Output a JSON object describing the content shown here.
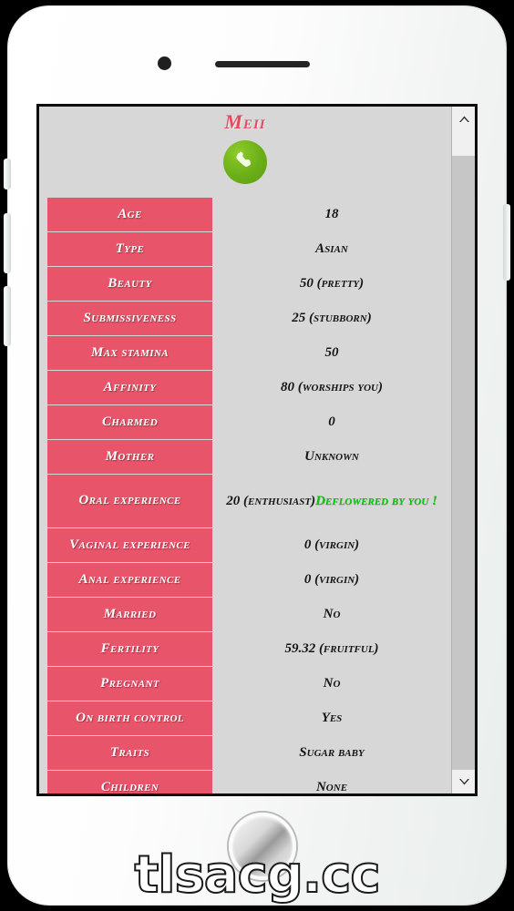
{
  "device": {
    "camera_icon": "front-camera-dot",
    "speaker_icon": "earpiece-speaker-bar",
    "home_button_icon": "home-button",
    "side_buttons": [
      "silent-switch",
      "volume-up",
      "volume-down",
      "power"
    ]
  },
  "header": {
    "character_name": "Meii",
    "call_icon": "phone-handset-icon",
    "name_color": "#e44a5c",
    "call_button_color": "#6cb018"
  },
  "stats": {
    "label_color": "#e8556a",
    "highlight_color": "#03c803",
    "background_color": "#d7d7d7",
    "rows": [
      {
        "label": "Age",
        "value": "18",
        "extra": "",
        "tall": false
      },
      {
        "label": "Type",
        "value": "Asian",
        "extra": "",
        "tall": false
      },
      {
        "label": "Beauty",
        "value": "50 (pretty)",
        "extra": "",
        "tall": false
      },
      {
        "label": "Submissiveness",
        "value": "25 (stubborn)",
        "extra": "",
        "tall": false
      },
      {
        "label": "Max stamina",
        "value": "50",
        "extra": "",
        "tall": false
      },
      {
        "label": "Affinity",
        "value": "80 (worships you)",
        "extra": "",
        "tall": false
      },
      {
        "label": "Charmed",
        "value": "0",
        "extra": "",
        "tall": false
      },
      {
        "label": "Mother",
        "value": "Unknown",
        "extra": "",
        "tall": false
      },
      {
        "label": "Oral experience",
        "value": "20 (enthusiast)",
        "extra": "Deflowered by you !",
        "tall": true
      },
      {
        "label": "Vaginal experience",
        "value": "0 (virgin)",
        "extra": "",
        "tall": false
      },
      {
        "label": "Anal experience",
        "value": "0 (virgin)",
        "extra": "",
        "tall": false
      },
      {
        "label": "Married",
        "value": "No",
        "extra": "",
        "tall": false
      },
      {
        "label": "Fertility",
        "value": "59.32 (fruitful)",
        "extra": "",
        "tall": false
      },
      {
        "label": "Pregnant",
        "value": "No",
        "extra": "",
        "tall": false
      },
      {
        "label": "On birth control",
        "value": "Yes",
        "extra": "",
        "tall": false
      },
      {
        "label": "Traits",
        "value": "Sugar baby",
        "extra": "",
        "tall": false
      },
      {
        "label": "Children",
        "value": "None",
        "extra": "",
        "tall": false
      }
    ]
  },
  "scrollbar": {
    "up_arrow_icon": "chevron-up-icon",
    "down_arrow_icon": "chevron-down-icon",
    "thumb_name": "scroll-thumb"
  },
  "watermark": {
    "text": "tlsacg.cc"
  }
}
